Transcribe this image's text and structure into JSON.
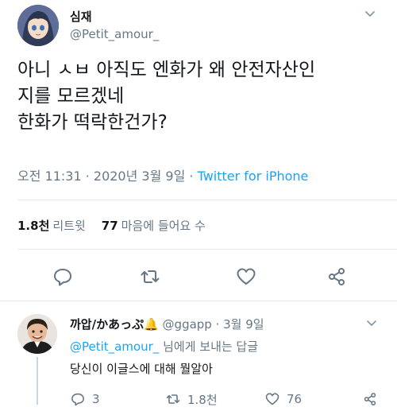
{
  "tweet": {
    "name": "심재",
    "handle": "@Petit_amour_",
    "body_lines": [
      "아니 ㅅㅂ 아직도 엔화가 왜 안전자산인",
      "지를 모르겠네",
      "한화가 떡락한건가?"
    ],
    "timestamp": "오전 11:31 · 2020년 3월 9일",
    "separator": " · ",
    "source": "Twitter for iPhone",
    "retweets_count": "1.8천",
    "retweets_label": "리트윗",
    "likes_count": "77",
    "likes_label": "마음에 들어요 수"
  },
  "reply": {
    "name": "까압/かあっぷ🔔",
    "handle": "@ggapp",
    "date": "3월 9일",
    "dot": " · ",
    "mention": "@Petit_amour_",
    "replying_suffix": " 님에게 보내는 답글",
    "text": "당신이 이글스에 대해 뭘알아",
    "reply_count": "3",
    "retweet_count": "1.8천",
    "like_count": "76"
  },
  "colors": {
    "text": "#14171a",
    "secondary": "#657786",
    "link": "#1da1f2",
    "divider": "#e1e8ed"
  },
  "icons": [
    "reply-icon",
    "retweet-icon",
    "like-icon",
    "share-icon",
    "chevron-down-icon"
  ]
}
